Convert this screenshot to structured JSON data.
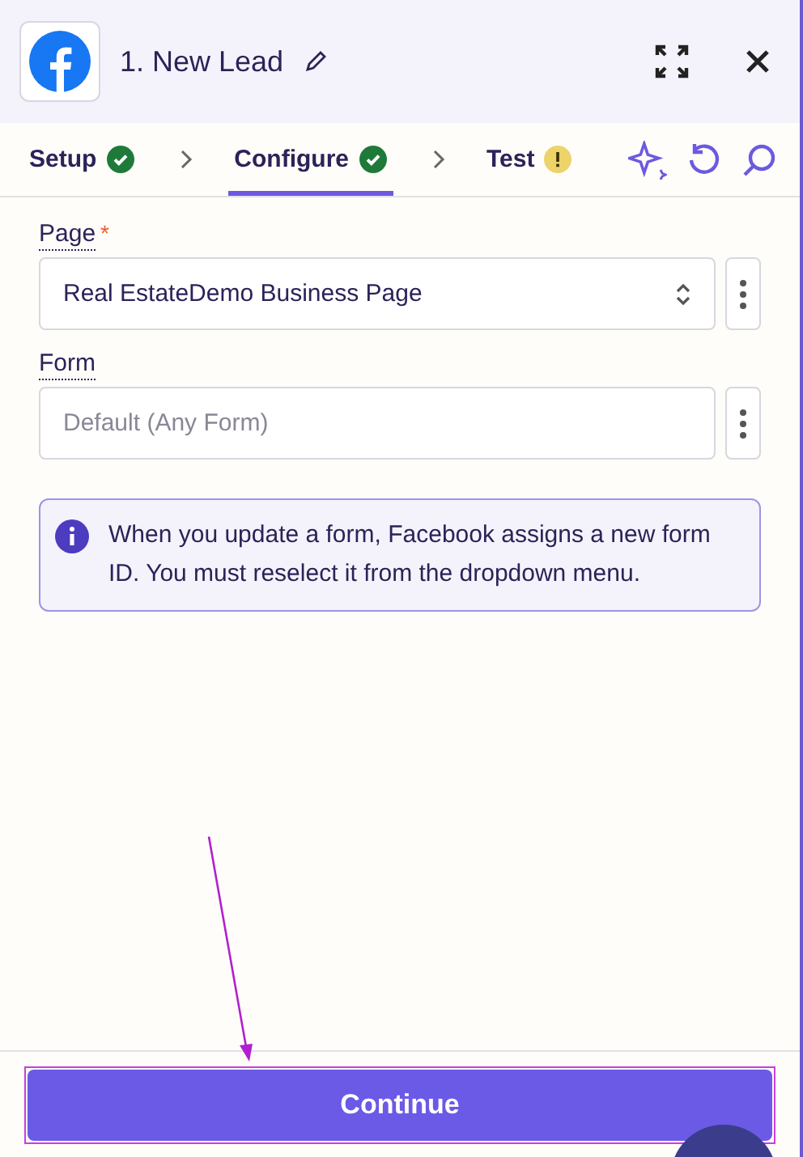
{
  "header": {
    "title": "1. New Lead"
  },
  "steps": [
    {
      "label": "Setup",
      "complete": true,
      "selected": false
    },
    {
      "label": "Configure",
      "complete": true,
      "selected": true
    },
    {
      "label": "Test",
      "complete": false,
      "selected": false
    }
  ],
  "fields": [
    {
      "label": "Page",
      "required_mark": "*",
      "value": "Real EstateDemo Business Page"
    },
    {
      "label": "Form",
      "placeholder": "Default (Any Form)"
    }
  ],
  "info": {
    "text": "When you update a form, Facebook assigns a new form ID. You must reselect it from the dropdown menu."
  },
  "continue_button": {
    "label": "Continue"
  }
}
